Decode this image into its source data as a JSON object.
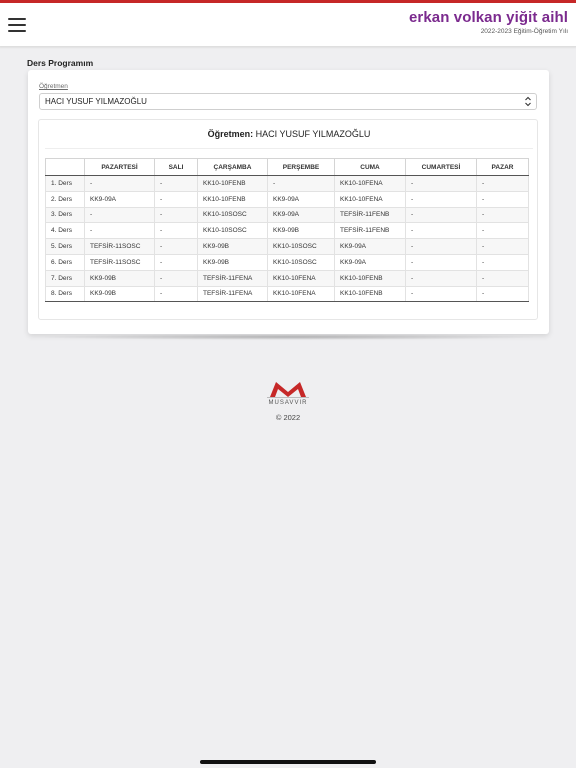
{
  "header": {
    "school_name": "erkan volkan yiğit aihl",
    "academic_year": "2022-2023 Eğitim-Öğretim Yılı"
  },
  "page": {
    "title": "Ders Programım"
  },
  "teacher_select": {
    "label": "Öğretmen",
    "value": "HACI YUSUF YILMAZOĞLU"
  },
  "schedule": {
    "heading_label": "Öğretmen:",
    "heading_value": "HACI YUSUF YILMAZOĞLU",
    "columns": [
      "",
      "PAZARTESİ",
      "SALI",
      "ÇARŞAMBA",
      "PERŞEMBE",
      "CUMA",
      "CUMARTESİ",
      "PAZAR"
    ],
    "rows": [
      [
        "1. Ders",
        "-",
        "-",
        "KK10-10FENB",
        "-",
        "KK10-10FENA",
        "-",
        "-"
      ],
      [
        "2. Ders",
        "KK9-09A",
        "-",
        "KK10-10FENB",
        "KK9-09A",
        "KK10-10FENA",
        "-",
        "-"
      ],
      [
        "3. Ders",
        "-",
        "-",
        "KK10-10SOSC",
        "KK9-09A",
        "TEFSİR-11FENB",
        "-",
        "-"
      ],
      [
        "4. Ders",
        "-",
        "-",
        "KK10-10SOSC",
        "KK9-09B",
        "TEFSİR-11FENB",
        "-",
        "-"
      ],
      [
        "5. Ders",
        "TEFSİR-11SOSC",
        "-",
        "KK9-09B",
        "KK10-10SOSC",
        "KK9-09A",
        "-",
        "-"
      ],
      [
        "6. Ders",
        "TEFSİR-11SOSC",
        "-",
        "KK9-09B",
        "KK10-10SOSC",
        "KK9-09A",
        "-",
        "-"
      ],
      [
        "7. Ders",
        "KK9-09B",
        "-",
        "TEFSİR-11FENA",
        "KK10-10FENA",
        "KK10-10FENB",
        "-",
        "-"
      ],
      [
        "8. Ders",
        "KK9-09B",
        "-",
        "TEFSİR-11FENA",
        "KK10-10FENA",
        "KK10-10FENB",
        "-",
        "-"
      ]
    ]
  },
  "footer": {
    "logo_text": "MUSAVVIR",
    "copyright": "© 2022"
  },
  "colors": {
    "accent_red": "#c62828",
    "brand_purple": "#7b2a8e"
  }
}
